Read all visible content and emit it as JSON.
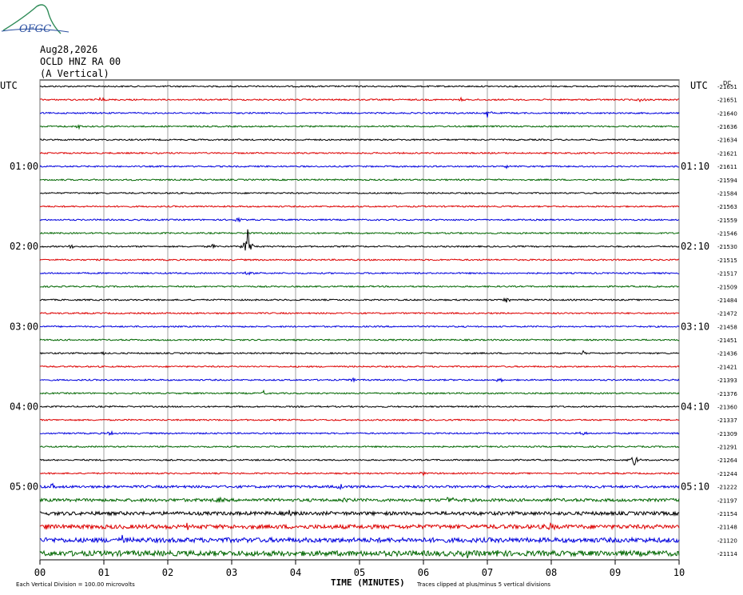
{
  "header": {
    "logo_text": "OFGC",
    "date": "Aug28,2026",
    "station": "OCLD HNZ RA 00",
    "component": "(A Vertical)"
  },
  "chart_data": {
    "type": "line",
    "subtype": "helicorder",
    "left_axis_label": "UTC",
    "right_axis_label": "UTC",
    "dc_header": "DC",
    "left_time_labels": [
      {
        "row": 6,
        "label": "01:00"
      },
      {
        "row": 12,
        "label": "02:00"
      },
      {
        "row": 18,
        "label": "03:00"
      },
      {
        "row": 24,
        "label": "04:00"
      },
      {
        "row": 30,
        "label": "05:00"
      }
    ],
    "right_time_labels": [
      {
        "row": 6,
        "label": "01:10"
      },
      {
        "row": 12,
        "label": "02:10"
      },
      {
        "row": 18,
        "label": "03:10"
      },
      {
        "row": 24,
        "label": "04:10"
      },
      {
        "row": 30,
        "label": "05:10"
      }
    ],
    "dc_offsets": [
      "-21651",
      "-21651",
      "-21640",
      "-21636",
      "-21634",
      "-21621",
      "-21611",
      "-21594",
      "-21584",
      "-21563",
      "-21559",
      "-21546",
      "-21530",
      "-21515",
      "-21517",
      "-21509",
      "-21484",
      "-21472",
      "-21458",
      "-21451",
      "-21436",
      "-21421",
      "-21393",
      "-21376",
      "-21360",
      "-21337",
      "-21309",
      "-21291",
      "-21264",
      "-21244",
      "-21222",
      "-21197",
      "-21154",
      "-21148",
      "-21120",
      "-21114"
    ],
    "trace_colors": [
      "#000000",
      "#dd0000",
      "#0000dd",
      "#006600"
    ],
    "xlabel": "TIME (MINUTES)",
    "x_ticks": [
      "00",
      "01",
      "02",
      "03",
      "04",
      "05",
      "06",
      "07",
      "08",
      "09",
      "10"
    ],
    "xlim": [
      0,
      10
    ],
    "footer_left": "Each Vertical Division =  100.00 microvolts",
    "footer_right": "Traces clipped at plus/minus 5 vertical divisions",
    "events": [
      {
        "row": 1,
        "minute": 0.95,
        "amp": 3
      },
      {
        "row": 1,
        "minute": 6.6,
        "amp": 3
      },
      {
        "row": 1,
        "minute": 9.4,
        "amp": 4
      },
      {
        "row": 2,
        "minute": 7.0,
        "amp": 7
      },
      {
        "row": 3,
        "minute": 0.6,
        "amp": 3
      },
      {
        "row": 6,
        "minute": 7.3,
        "amp": 3
      },
      {
        "row": 10,
        "minute": 3.1,
        "amp": 3
      },
      {
        "row": 12,
        "minute": 0.5,
        "amp": 4
      },
      {
        "row": 12,
        "minute": 2.7,
        "amp": 3
      },
      {
        "row": 12,
        "minute": 3.25,
        "amp": 22
      },
      {
        "row": 14,
        "minute": 3.25,
        "amp": 4
      },
      {
        "row": 16,
        "minute": 7.3,
        "amp": 4
      },
      {
        "row": 20,
        "minute": 1.0,
        "amp": 3
      },
      {
        "row": 20,
        "minute": 8.5,
        "amp": 3
      },
      {
        "row": 22,
        "minute": 4.9,
        "amp": 3
      },
      {
        "row": 22,
        "minute": 7.2,
        "amp": 4
      },
      {
        "row": 23,
        "minute": 3.5,
        "amp": 3
      },
      {
        "row": 25,
        "minute": 7.4,
        "amp": 3
      },
      {
        "row": 26,
        "minute": 1.1,
        "amp": 5
      },
      {
        "row": 26,
        "minute": 8.5,
        "amp": 4
      },
      {
        "row": 28,
        "minute": 9.3,
        "amp": 8
      },
      {
        "row": 29,
        "minute": 6.0,
        "amp": 3
      },
      {
        "row": 30,
        "minute": 0.2,
        "amp": 4
      },
      {
        "row": 30,
        "minute": 4.7,
        "amp": 3
      },
      {
        "row": 31,
        "minute": 2.8,
        "amp": 4
      },
      {
        "row": 31,
        "minute": 4.8,
        "amp": 4
      },
      {
        "row": 31,
        "minute": 6.4,
        "amp": 6
      },
      {
        "row": 32,
        "minute": 3.9,
        "amp": 3
      },
      {
        "row": 33,
        "minute": 0.1,
        "amp": 4
      },
      {
        "row": 33,
        "minute": 2.3,
        "amp": 5
      },
      {
        "row": 33,
        "minute": 8.0,
        "amp": 4
      },
      {
        "row": 34,
        "minute": 1.3,
        "amp": 7
      },
      {
        "row": 34,
        "minute": 3.2,
        "amp": 5
      },
      {
        "row": 35,
        "minute": 6.7,
        "amp": 7
      },
      {
        "row": 35,
        "minute": 7.2,
        "amp": 6
      }
    ]
  }
}
